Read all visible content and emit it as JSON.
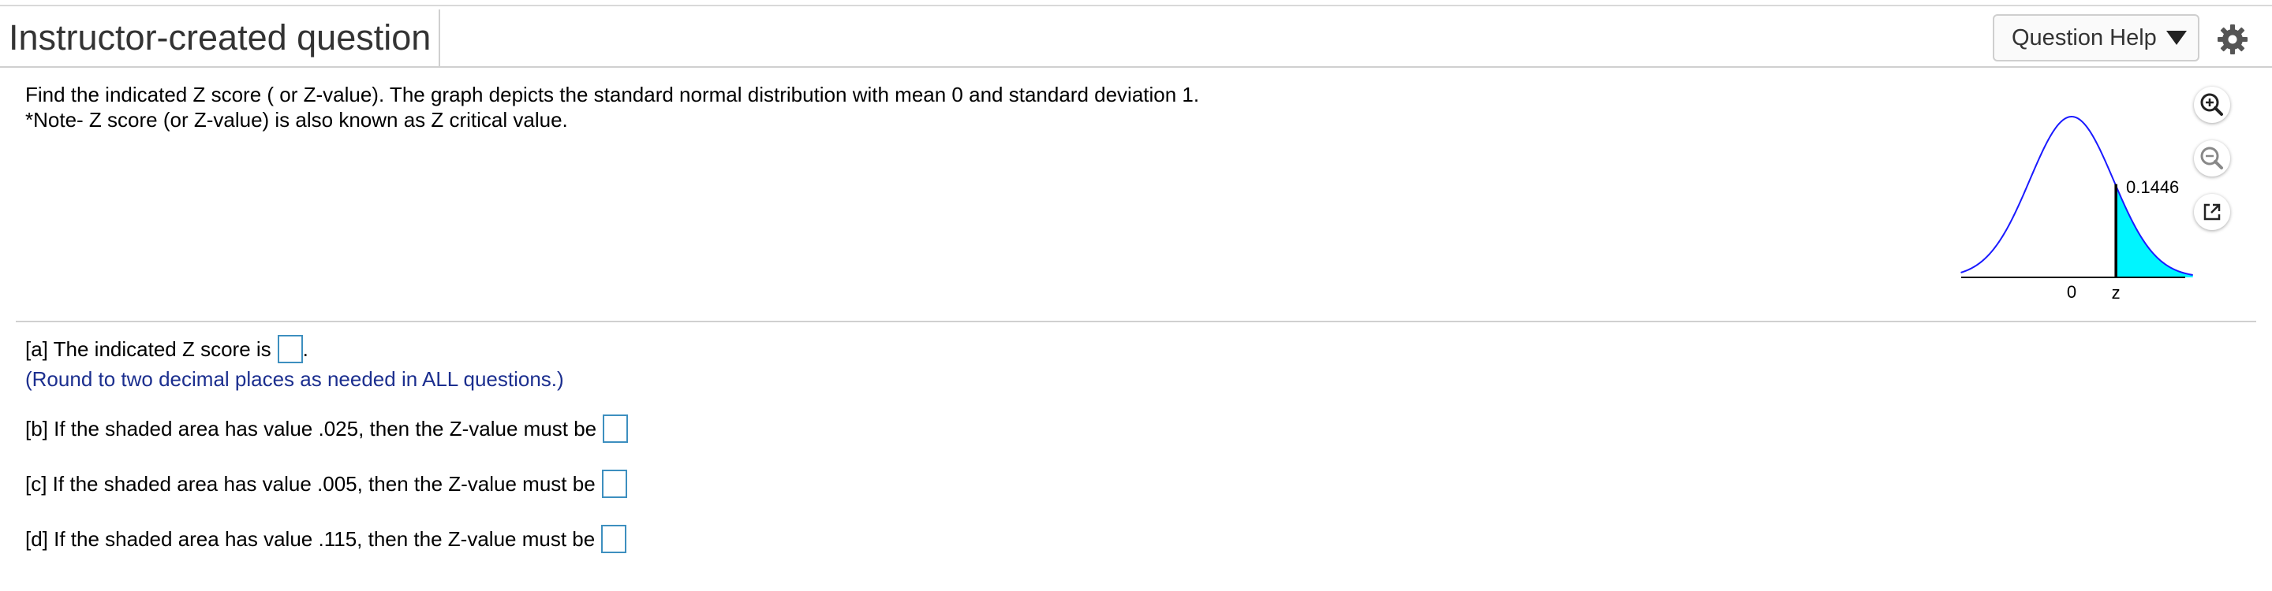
{
  "header": {
    "title": "Instructor-created question",
    "help_label": "Question Help"
  },
  "problem": {
    "line1": "Find the indicated Z score ( or Z-value). The graph depicts the standard normal distribution with mean 0 and standard deviation 1.",
    "line2": "*Note- Z score (or Z-value) is also known as Z critical value."
  },
  "graph": {
    "area_label": "0.1446",
    "mean_label": "0",
    "z_label": "z",
    "shaded_area": 0.1446,
    "colors": {
      "curve": "#1a1aff",
      "fill": "#00f5ff",
      "axis": "#000000"
    }
  },
  "tools": {
    "zoom_in_icon": "zoom-in-icon",
    "zoom_out_icon": "zoom-out-icon",
    "popout_icon": "popout-icon"
  },
  "questions": [
    {
      "text": "[a] The indicated Z score is",
      "suffix": "."
    },
    {
      "text": "[b] If the shaded area has value .025, then the Z-value must be"
    },
    {
      "text": "[c] If the shaded area has value .005, then the Z-value must be"
    },
    {
      "text": "[d] If the shaded area has value .115, then the Z-value must be"
    }
  ],
  "note": "(Round to two decimal places as needed in ALL questions.)"
}
